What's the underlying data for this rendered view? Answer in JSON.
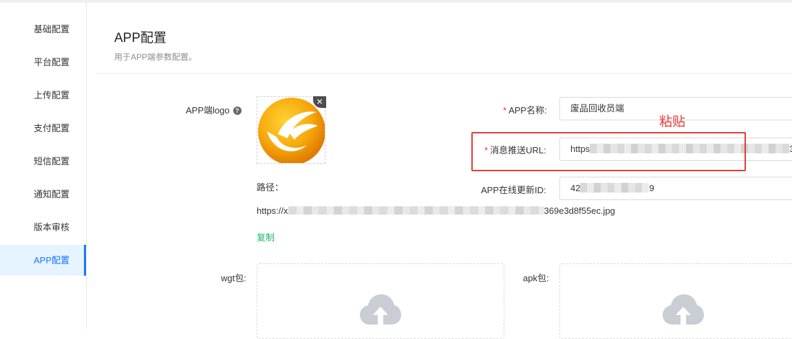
{
  "sidebar": {
    "items": [
      {
        "label": "基础配置",
        "active": false
      },
      {
        "label": "平台配置",
        "active": false
      },
      {
        "label": "上传配置",
        "active": false
      },
      {
        "label": "支付配置",
        "active": false
      },
      {
        "label": "短信配置",
        "active": false
      },
      {
        "label": "通知配置",
        "active": false
      },
      {
        "label": "版本审核",
        "active": false
      },
      {
        "label": "APP配置",
        "active": true
      }
    ]
  },
  "header": {
    "title": "APP配置",
    "subtitle": "用于APP端参数配置。"
  },
  "form": {
    "logo": {
      "label": "APP端logo",
      "help_icon": "question-circle-icon",
      "remove_icon": "close-icon",
      "path_label": "路径：",
      "path_prefix": "https://x",
      "path_suffix": "369e3d8f55ec.jpg",
      "copy_label": "复制"
    },
    "app_name": {
      "required_mark": "*",
      "label": "APP名称:",
      "value": "废品回收员端"
    },
    "push_url": {
      "required_mark": "*",
      "label": "消息推送URL:",
      "value_prefix": "https",
      "value_suffix": "3"
    },
    "update_id": {
      "label": "APP在线更新ID:",
      "value_prefix": "42",
      "value_suffix": "9"
    },
    "wgt": {
      "label": "wgt包:",
      "icon": "cloud-upload-icon"
    },
    "apk": {
      "label": "apk包:",
      "icon": "cloud-upload-icon"
    }
  },
  "annotation": {
    "note": "粘贴",
    "color": "#e53935"
  },
  "colors": {
    "accent": "#1677ff",
    "active_bg": "#e6f4ff",
    "link_green": "#18b566",
    "required_red": "#f5222d"
  }
}
